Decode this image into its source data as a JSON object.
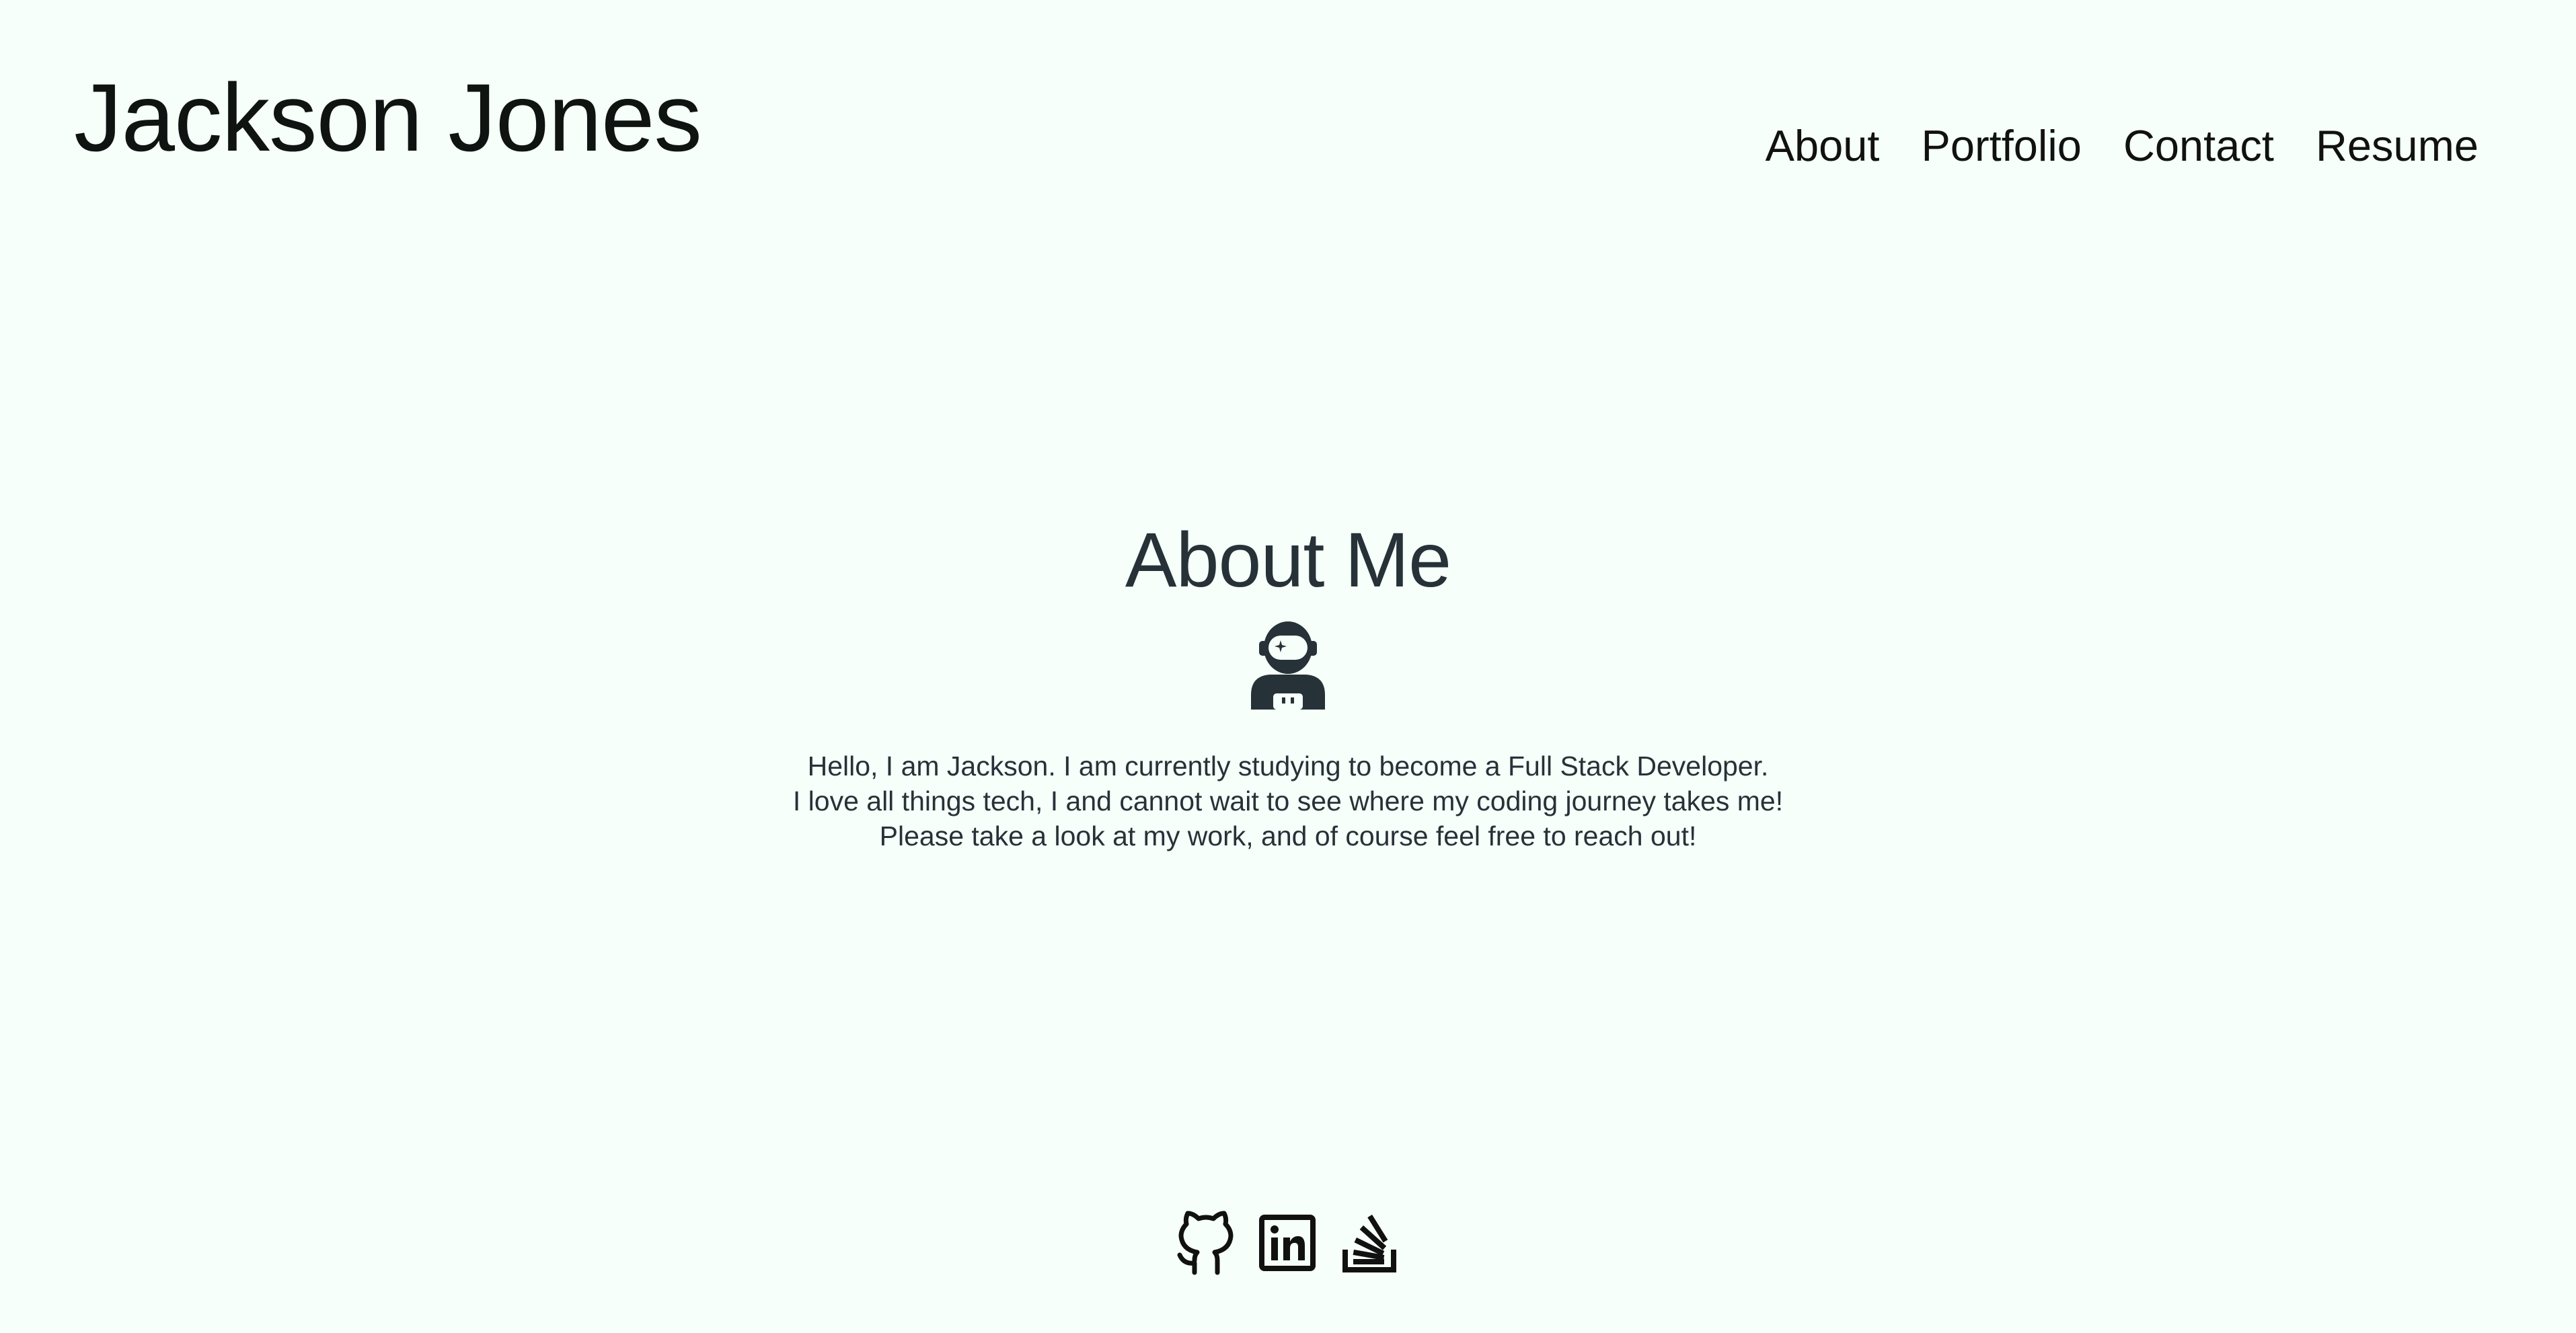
{
  "header": {
    "site_name": "Jackson Jones",
    "nav": [
      {
        "label": "About"
      },
      {
        "label": "Portfolio"
      },
      {
        "label": "Contact"
      },
      {
        "label": "Resume"
      }
    ]
  },
  "about": {
    "title": "About Me",
    "avatar_icon": "astronaut-icon",
    "bio_lines": [
      "Hello, I am Jackson. I am currently studying to become a Full Stack Developer.",
      "I love all things tech, I and cannot wait to see where my coding journey takes me!",
      "Please take a look at my work, and of course feel free to reach out!"
    ]
  },
  "footer": {
    "social_icons": [
      "github-icon",
      "linkedin-icon",
      "stackoverflow-icon"
    ]
  },
  "colors": {
    "background": "#f6fff9",
    "text": "#111111",
    "heading": "#263238"
  }
}
